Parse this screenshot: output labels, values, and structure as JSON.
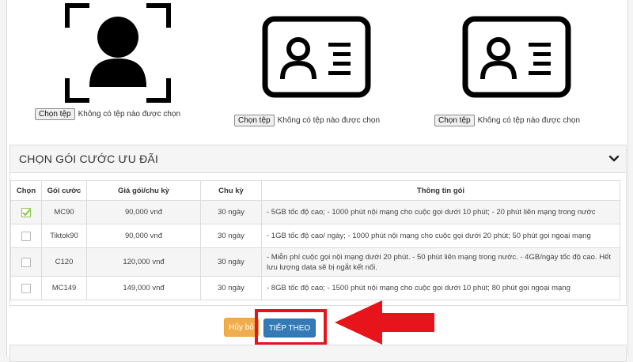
{
  "upload": {
    "items": [
      {
        "icon": "face-scan-icon",
        "button": "Chọn tệp",
        "status": "Không có tệp nào được chọn"
      },
      {
        "icon": "id-card-front-icon",
        "button": "Chọn tệp",
        "status": "Không có tệp nào được chọn"
      },
      {
        "icon": "id-card-back-icon",
        "button": "Chọn tệp",
        "status": "Không có tệp nào được chọn"
      }
    ]
  },
  "panel": {
    "title": "CHỌN GÓI CƯỚC ƯU ĐÃI",
    "chevron_icon": "chevron-down-icon"
  },
  "table": {
    "headers": [
      "Chọn",
      "Gói cước",
      "Giá gói/chu kỳ",
      "Chu kỳ",
      "Thông tin gói"
    ],
    "rows": [
      {
        "checked": true,
        "name": "MC90",
        "price": "90,000 vnđ",
        "cycle": "30 ngày",
        "info": "- 5GB tốc độ cao; - 1000 phút nội mạng cho cuộc gọi dưới 10 phút; - 20 phút liên mạng trong nước"
      },
      {
        "checked": false,
        "name": "Tiktok90",
        "price": "90,000 vnđ",
        "cycle": "30 ngày",
        "info": "- 1GB tốc độ cao/ ngày; - 1000 phút nội mạng cho cuộc gọi dưới 20 phút; 50 phút gọi ngoại mạng"
      },
      {
        "checked": false,
        "name": "C120",
        "price": "120,000 vnđ",
        "cycle": "30 ngày",
        "info": "- Miễn phí cuộc gọi nội mạng dưới 20 phút. - 50 phút liên mạng trong nước. - 4GB/ngày tốc độ cao. Hết lưu lượng data sẽ bị ngắt kết nối."
      },
      {
        "checked": false,
        "name": "MC149",
        "price": "149,000 vnđ",
        "cycle": "30 ngày",
        "info": "- 8GB tốc độ cao; - 1500 phút nội mạng cho cuộc gọi dưới 10 phút; 80 phút gọi ngoại mạng"
      }
    ]
  },
  "actions": {
    "cancel_label": "Hủy bỏ",
    "next_label": "TIẾP THEO"
  },
  "colors": {
    "checked": "#8bc34a",
    "cancel": "#f0ad4e",
    "next": "#337ab7",
    "annotation": "#e8141b"
  }
}
